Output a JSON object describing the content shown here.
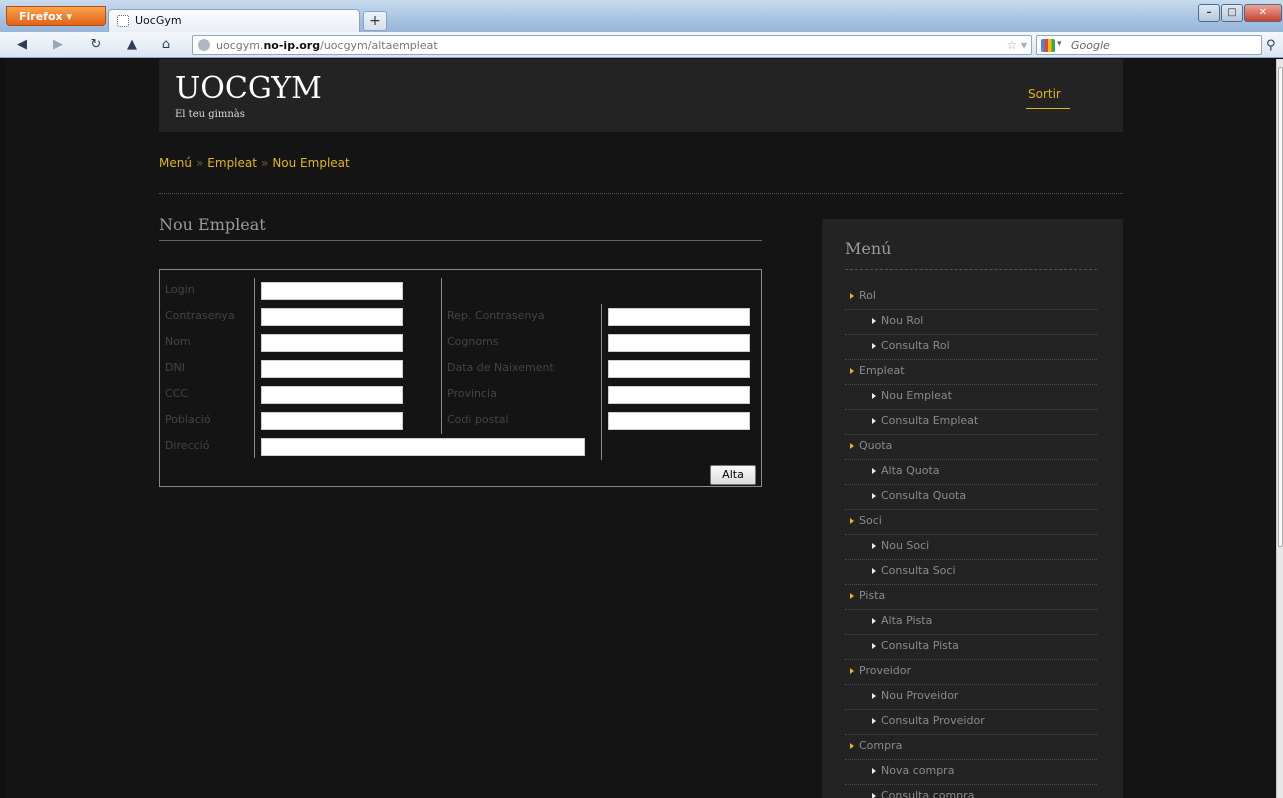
{
  "browser": {
    "app_button": "Firefox",
    "tab_title": "UocGym",
    "new_tab": "+",
    "url_prefix": "uocgym.",
    "url_domain": "no-ip.org",
    "url_path": "/uocgym/altaempleat",
    "search_placeholder": "Google",
    "icons": [
      "back-icon",
      "forward-icon",
      "reload-icon",
      "bookmark-bird-icon",
      "home-icon",
      "globe-icon",
      "star-icon",
      "google-logo-icon",
      "search-icon"
    ]
  },
  "header": {
    "logo": "UOCGYM",
    "tagline": "El teu gimnàs",
    "logout_label": "Sortir"
  },
  "breadcrumb": {
    "items": [
      "Menú",
      "Empleat",
      "Nou Empleat"
    ],
    "separator": "»"
  },
  "form": {
    "title": "Nou Empleat",
    "submit_label": "Alta",
    "fields": {
      "login": {
        "label": "Login",
        "value": ""
      },
      "password": {
        "label": "Contrasenya",
        "value": ""
      },
      "repeat_password": {
        "label": "Rep. Contrasenya",
        "value": ""
      },
      "name": {
        "label": "Nom",
        "value": ""
      },
      "surnames": {
        "label": "Cognoms",
        "value": ""
      },
      "dni": {
        "label": "DNI",
        "value": ""
      },
      "birth_date": {
        "label": "Data de Naixement",
        "value": ""
      },
      "ccc": {
        "label": "CCC",
        "value": ""
      },
      "province": {
        "label": "Provincia",
        "value": ""
      },
      "town": {
        "label": "Població",
        "value": ""
      },
      "postal_code": {
        "label": "Codi postal",
        "value": ""
      },
      "address": {
        "label": "Direcció",
        "value": ""
      }
    }
  },
  "sidebar": {
    "title": "Menú",
    "items": [
      {
        "label": "Rol",
        "level": 0
      },
      {
        "label": "Nou Rol",
        "level": 1
      },
      {
        "label": "Consulta Rol",
        "level": 1
      },
      {
        "label": "Empleat",
        "level": 0
      },
      {
        "label": "Nou Empleat",
        "level": 1
      },
      {
        "label": "Consulta Empleat",
        "level": 1
      },
      {
        "label": "Quota",
        "level": 0
      },
      {
        "label": "Alta Quota",
        "level": 1
      },
      {
        "label": "Consulta Quota",
        "level": 1
      },
      {
        "label": "Soci",
        "level": 0
      },
      {
        "label": "Nou Soci",
        "level": 1
      },
      {
        "label": "Consulta Soci",
        "level": 1
      },
      {
        "label": "Pista",
        "level": 0
      },
      {
        "label": "Alta Pista",
        "level": 1
      },
      {
        "label": "Consulta Pista",
        "level": 1
      },
      {
        "label": "Proveidor",
        "level": 0
      },
      {
        "label": "Nou Proveidor",
        "level": 1
      },
      {
        "label": "Consulta Proveidor",
        "level": 1
      },
      {
        "label": "Compra",
        "level": 0
      },
      {
        "label": "Nova compra",
        "level": 1
      },
      {
        "label": "Consulta compra",
        "level": 1
      }
    ]
  },
  "colors": {
    "accent": "#e2b51a",
    "background": "#141414",
    "panel": "#232323"
  }
}
